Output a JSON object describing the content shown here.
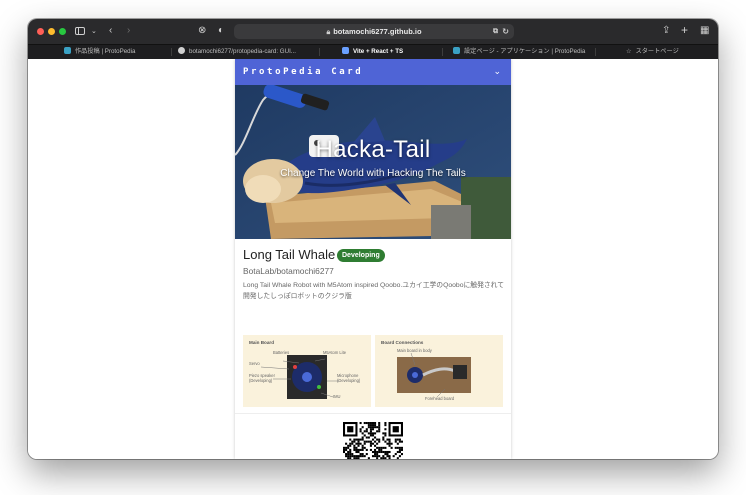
{
  "browser": {
    "url": "botamochi6277.github.io",
    "tabs": [
      {
        "label": "作品投稿 | ProtoPedia",
        "active": false,
        "favicon_color": "#3aa1c4"
      },
      {
        "label": "botamochi6277/protopedia-card: GUI...",
        "active": false,
        "favicon_color": "#d0d0d0"
      },
      {
        "label": "Vite + React + TS",
        "active": true,
        "favicon_color": "#6aa0ff"
      },
      {
        "label": "設定ページ - アプリケーション | ProtoPedia",
        "active": false,
        "favicon_color": "#3aa1c4"
      },
      {
        "label": "スタートページ",
        "active": false,
        "favicon_color": "#bdbdbd"
      }
    ],
    "colors": {
      "close": "#ff5f57",
      "minimize": "#febc2e",
      "zoom": "#28c840"
    }
  },
  "card": {
    "header_title": "ProtoPedia Card",
    "accent": "#4f64d6",
    "hero_title": "Hacka-Tail",
    "hero_subtitle": "Change The World with Hacking The Tails",
    "product_name": "Long Tail Whale",
    "status_badge": "Developing",
    "status_color": "#2f7d32",
    "team_name": "BotaLab/botamochi6277",
    "summary": "Long Tail Whale Robot with M5Atom inspired Qoobo.ユカイ工学のQooboに触発されて開発したしっぽロボットのクジラ版"
  },
  "diagrams": {
    "main_board": {
      "title": "Main Board",
      "labels": [
        "Batteries",
        "M5Atom Lite",
        "Servo",
        "Piezo speaker (Developing)",
        "Microphone (Developing)",
        "IMU"
      ]
    },
    "board_connections": {
      "title": "Board Connections",
      "labels": [
        "Main board in body",
        "Forehead board"
      ]
    }
  }
}
